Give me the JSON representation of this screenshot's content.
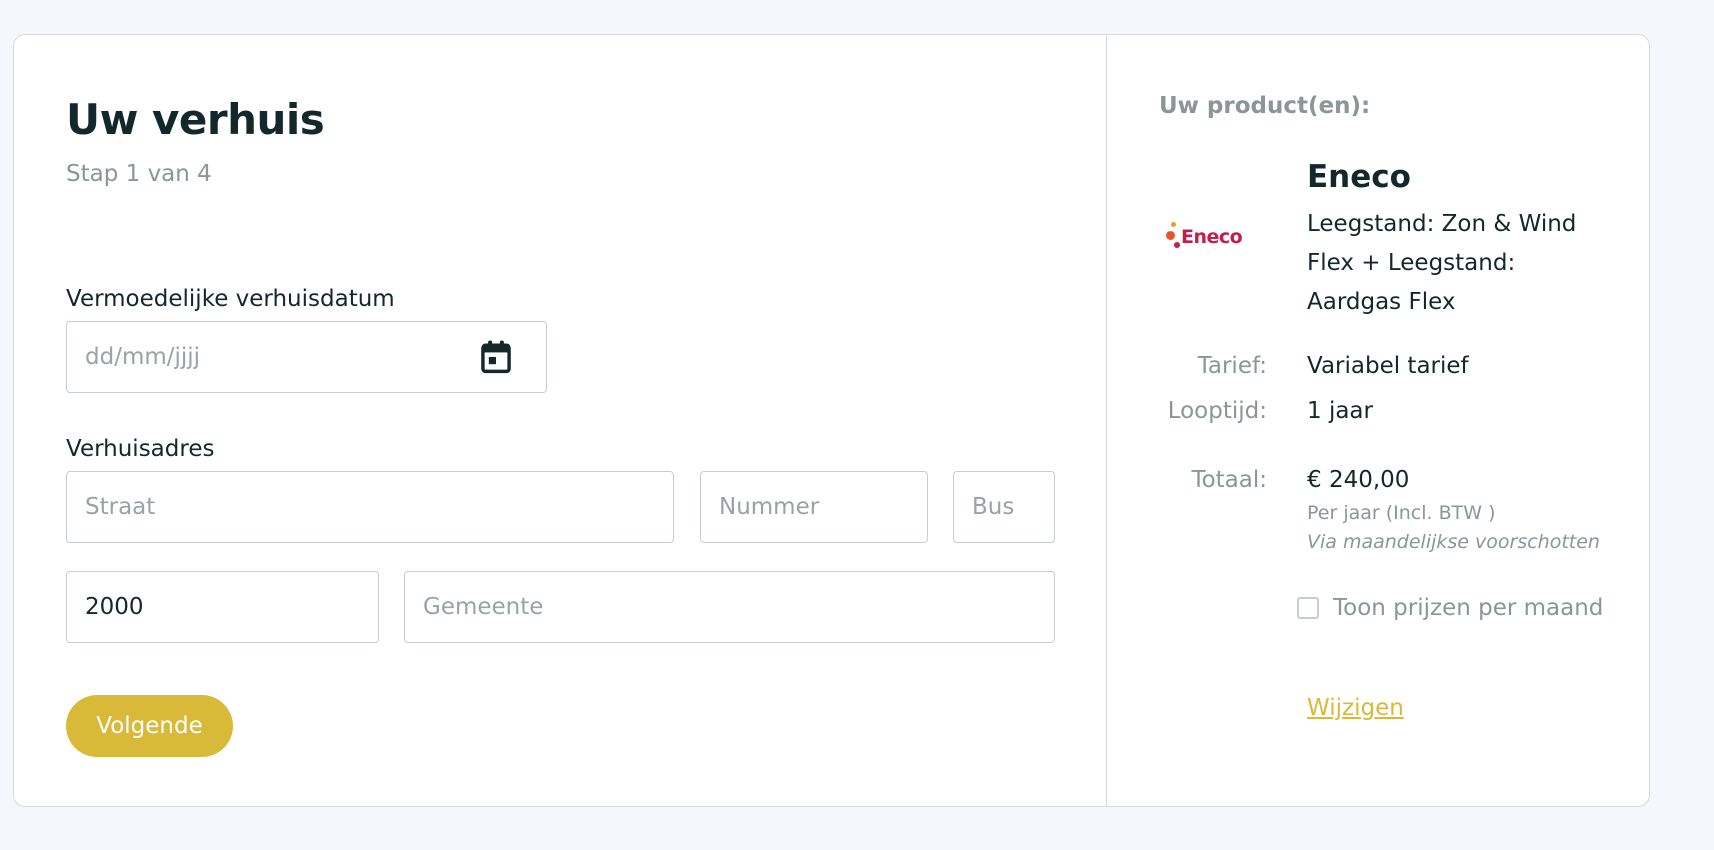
{
  "form": {
    "title": "Uw verhuis",
    "step": "Stap 1 van 4",
    "date_label": "Vermoedelijke verhuisdatum",
    "date_placeholder": "dd/mm/jjjj",
    "address_label": "Verhuisadres",
    "street_placeholder": "Straat",
    "number_placeholder": "Nummer",
    "bus_placeholder": "Bus",
    "postcode_value": "2000",
    "city_placeholder": "Gemeente",
    "next_label": "Volgende"
  },
  "summary": {
    "heading": "Uw product(en):",
    "brand": "Eneco",
    "logo_text": "Eneco",
    "product_description": "Leegstand: Zon & Wind Flex + Leegstand: Aardgas Flex",
    "tariff_label": "Tarief:",
    "tariff_value": "Variabel tarief",
    "term_label": "Looptijd:",
    "term_value": "1 jaar",
    "total_label": "Totaal:",
    "total_value": "€ 240,00",
    "per_year_note": "Per jaar (Incl. BTW )",
    "advance_note": "Via maandelijkse voorschotten",
    "monthly_toggle_label": "Toon prijzen per maand",
    "monthly_toggle_checked": false,
    "change_link": "Wijzigen"
  },
  "colors": {
    "accent": "#d9ba38",
    "text": "#13282b",
    "muted": "#8c9597",
    "border": "#c8cdd0",
    "brand_logo": "#c01f4a",
    "background": "#f6f7fc"
  },
  "icons": {
    "date_field": "calendar-icon"
  }
}
